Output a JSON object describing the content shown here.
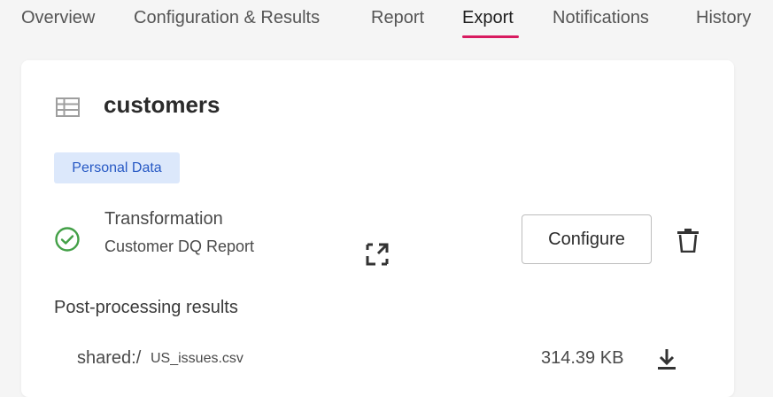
{
  "tabs": [
    {
      "label": "Overview",
      "active": false
    },
    {
      "label": "Configuration & Results",
      "active": false
    },
    {
      "label": "Report",
      "active": false
    },
    {
      "label": "Export",
      "active": true
    },
    {
      "label": "Notifications",
      "active": false
    },
    {
      "label": "History",
      "active": false
    }
  ],
  "colors": {
    "accent": "#d81b60",
    "badge_bg": "#dce8fb",
    "badge_text": "#2759c4",
    "success": "#43a047"
  },
  "card": {
    "table_icon": "table-icon",
    "table_name": "customers",
    "badge": "Personal Data",
    "transformation": {
      "status_icon": "check-circle-icon",
      "title": "Transformation",
      "subtitle": "Customer DQ Report",
      "expand_icon": "expand-icon",
      "configure_label": "Configure",
      "delete_icon": "trash-icon"
    },
    "post_processing": {
      "title": "Post-processing results",
      "files": [
        {
          "prefix": "shared:/",
          "name": "US_issues.csv",
          "size": "314.39 KB",
          "action_icon": "download-icon"
        }
      ]
    }
  }
}
